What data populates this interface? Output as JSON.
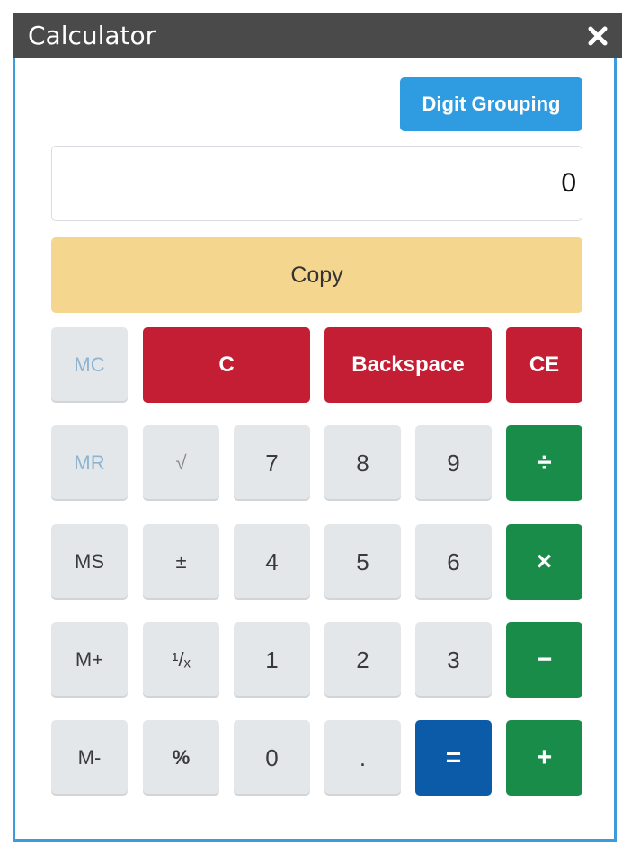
{
  "window": {
    "title": "Calculator",
    "close_glyph": "✖"
  },
  "toolbar": {
    "digit_grouping_label": "Digit Grouping"
  },
  "display": {
    "value": "0"
  },
  "copy_label": "Copy",
  "keys": {
    "mc": "MC",
    "c": "C",
    "backspace": "Backspace",
    "ce": "CE",
    "mr": "MR",
    "sqrt": "√",
    "seven": "7",
    "eight": "8",
    "nine": "9",
    "divide": "÷",
    "ms": "MS",
    "plusminus": "±",
    "four": "4",
    "five": "5",
    "six": "6",
    "multiply": "×",
    "mplus": "M+",
    "reciprocal": "¹/ₓ",
    "one": "1",
    "two": "2",
    "three": "3",
    "minus": "−",
    "mminus": "M-",
    "percent": "%",
    "zero": "0",
    "dot": ".",
    "equals": "=",
    "plus": "+"
  },
  "colors": {
    "titlebar": "#4a4a4a",
    "window_border": "#3d9bd9",
    "digit_grouping": "#2f9be0",
    "copy": "#f5d68e",
    "clear_keys": "#c41e35",
    "operator_keys": "#1a8c4a",
    "equals_key": "#0b5ba8",
    "number_keys": "#e4e7ea",
    "disabled_text": "#8eb4d1"
  }
}
